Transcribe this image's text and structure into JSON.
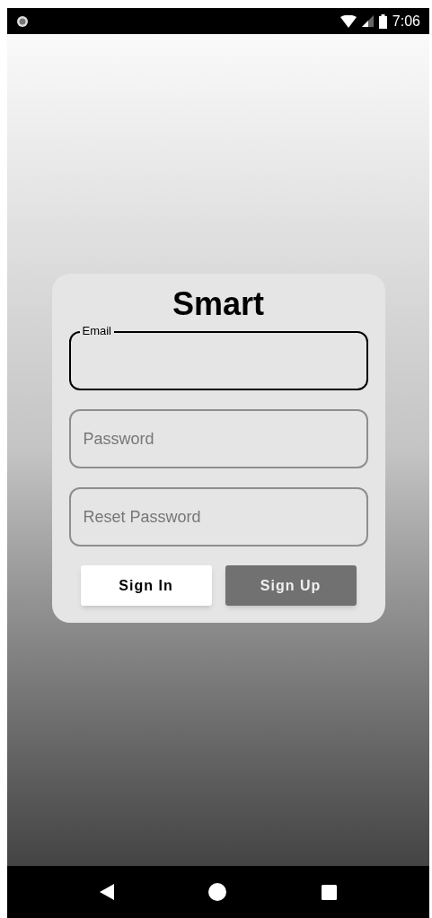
{
  "status_bar": {
    "time": "7:06"
  },
  "card": {
    "title": "Smart",
    "fields": [
      {
        "label": "Email",
        "focused": true
      },
      {
        "placeholder": "Password",
        "focused": false
      },
      {
        "placeholder": "Reset Password",
        "focused": false
      }
    ],
    "buttons": [
      {
        "label": "Sign In",
        "kind": "primary"
      },
      {
        "label": "Sign Up",
        "kind": "secondary"
      }
    ]
  }
}
